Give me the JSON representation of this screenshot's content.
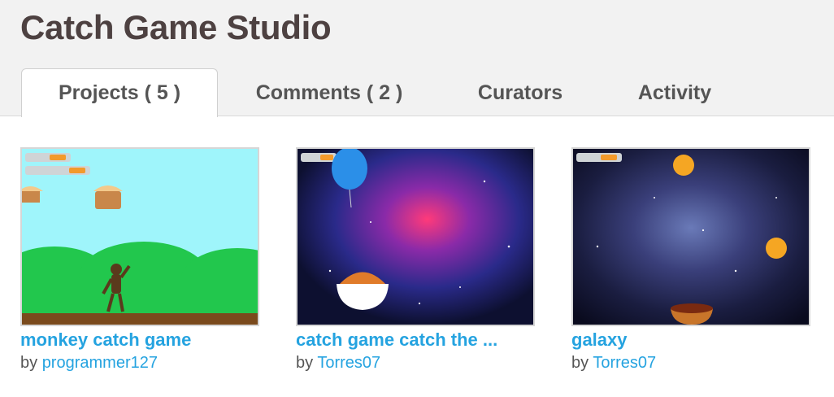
{
  "studio": {
    "title": "Catch Game Studio"
  },
  "tabs": [
    {
      "label": "Projects ( 5 )",
      "active": true
    },
    {
      "label": "Comments ( 2 )",
      "active": false
    },
    {
      "label": "Curators",
      "active": false
    },
    {
      "label": "Activity",
      "active": false
    }
  ],
  "projects": [
    {
      "title": "monkey catch game",
      "by": "by",
      "author": "programmer127",
      "thumb_icon": "monkey-game-thumbnail"
    },
    {
      "title": "catch game catch the ...",
      "by": "by",
      "author": "Torres07",
      "thumb_icon": "space-balloon-thumbnail"
    },
    {
      "title": "galaxy",
      "by": "by",
      "author": "Torres07",
      "thumb_icon": "galaxy-thumbnail"
    }
  ],
  "colors": {
    "link": "#25a3e0",
    "title": "#4d4141",
    "tab_text": "#555555",
    "header_bg": "#f2f2f2"
  }
}
